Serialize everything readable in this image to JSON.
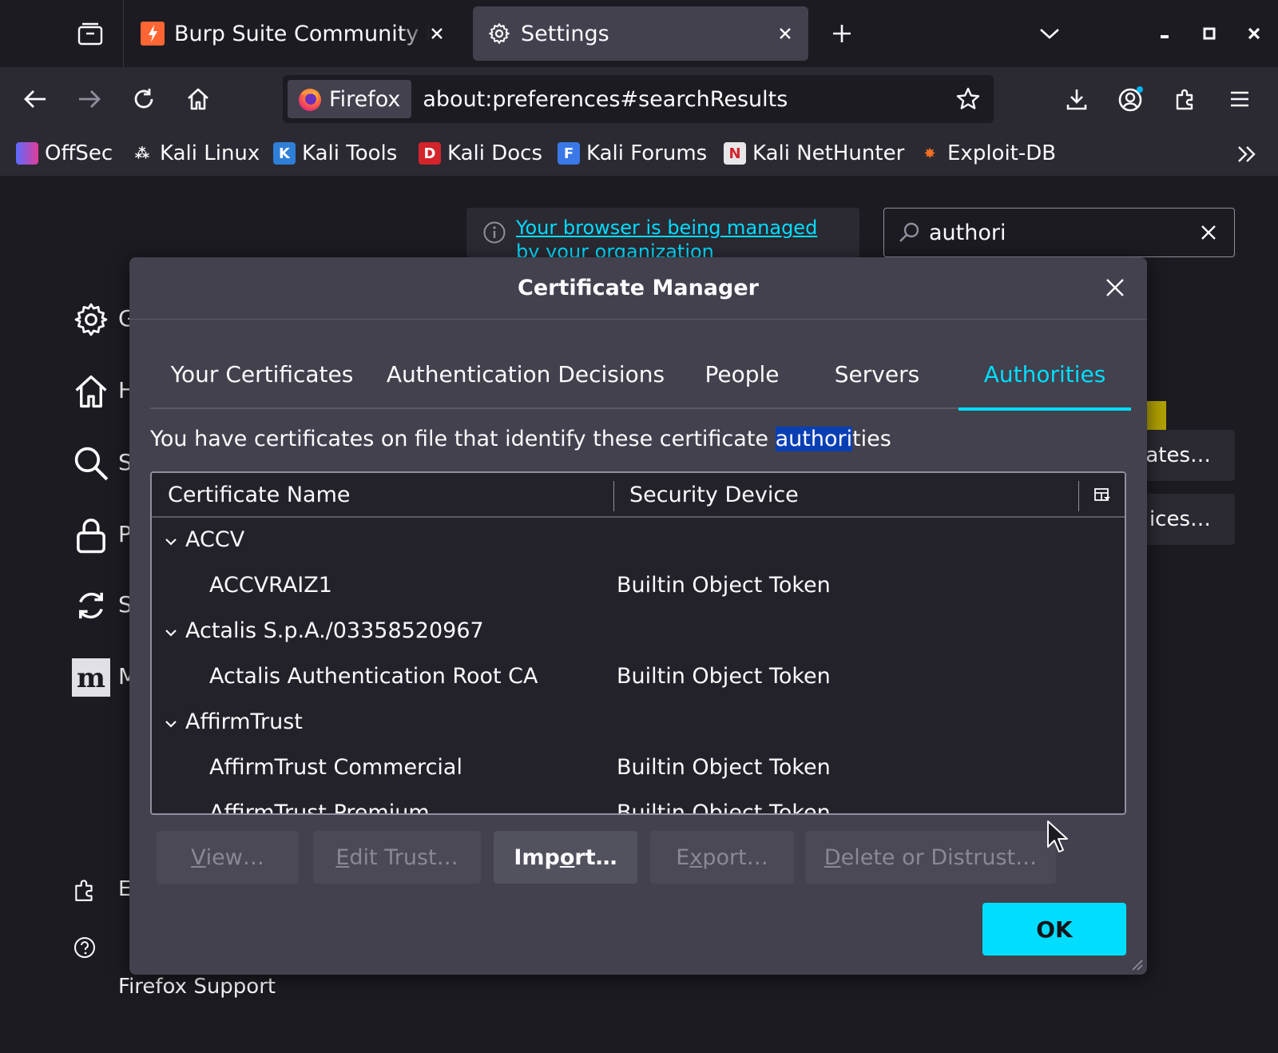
{
  "tabs": [
    {
      "title": "Burp Suite Community Ed",
      "active": false
    },
    {
      "title": "Settings",
      "active": true
    }
  ],
  "navbar": {
    "identity_label": "Firefox",
    "url": "about:preferences#searchResults"
  },
  "bookmarks": [
    {
      "label": "OffSec"
    },
    {
      "label": "Kali Linux"
    },
    {
      "label": "Kali Tools"
    },
    {
      "label": "Kali Docs"
    },
    {
      "label": "Kali Forums"
    },
    {
      "label": "Kali NetHunter"
    },
    {
      "label": "Exploit-DB"
    }
  ],
  "settings": {
    "managed_notice": "Your browser is being managed by your organization",
    "search_value": "authori",
    "categories": [
      "General",
      "Home",
      "Search",
      "Privacy & Security",
      "Sync",
      "More from Mozilla"
    ],
    "category_labels_visible": [
      "G",
      "H",
      "S",
      "P",
      "S",
      "M"
    ],
    "footer_extensions_visible": "E",
    "footer_support": "Firefox Support",
    "bg_button_1": "ates…",
    "bg_button_2": "ices…"
  },
  "dialog": {
    "title": "Certificate Manager",
    "tabs": [
      "Your Certificates",
      "Authentication Decisions",
      "People",
      "Servers",
      "Authorities"
    ],
    "selected_tab": "Authorities",
    "description_before": "You have certificates on file that identify these certificate ",
    "description_highlight": "authori",
    "description_after": "ties",
    "columns": [
      "Certificate Name",
      "Security Device"
    ],
    "rows": [
      {
        "type": "group",
        "name": "ACCV",
        "device": ""
      },
      {
        "type": "child",
        "name": "ACCVRAIZ1",
        "device": "Builtin Object Token"
      },
      {
        "type": "group",
        "name": "Actalis S.p.A./03358520967",
        "device": ""
      },
      {
        "type": "child",
        "name": "Actalis Authentication Root CA",
        "device": "Builtin Object Token"
      },
      {
        "type": "group",
        "name": "AffirmTrust",
        "device": ""
      },
      {
        "type": "child",
        "name": "AffirmTrust Commercial",
        "device": "Builtin Object Token"
      },
      {
        "type": "child",
        "name": "AffirmTrust Premium",
        "device": "Builtin Object Token"
      }
    ],
    "buttons": {
      "view": {
        "accesskey": "V",
        "rest": "iew…"
      },
      "edit_trust": {
        "accesskey": "E",
        "rest": "dit Trust…"
      },
      "import_pre": "Imp",
      "import_key": "o",
      "import_post": "rt…",
      "export_pre": "E",
      "export_key": "x",
      "export_post": "port…",
      "delete": {
        "accesskey": "D",
        "rest": "elete or Distrust…"
      }
    },
    "ok_label": "OK"
  },
  "colors": {
    "accent": "#00ddff",
    "dialog_bg": "#42414d",
    "page_bg": "#1c1b22",
    "selection_highlight": "#0a3fb4"
  }
}
